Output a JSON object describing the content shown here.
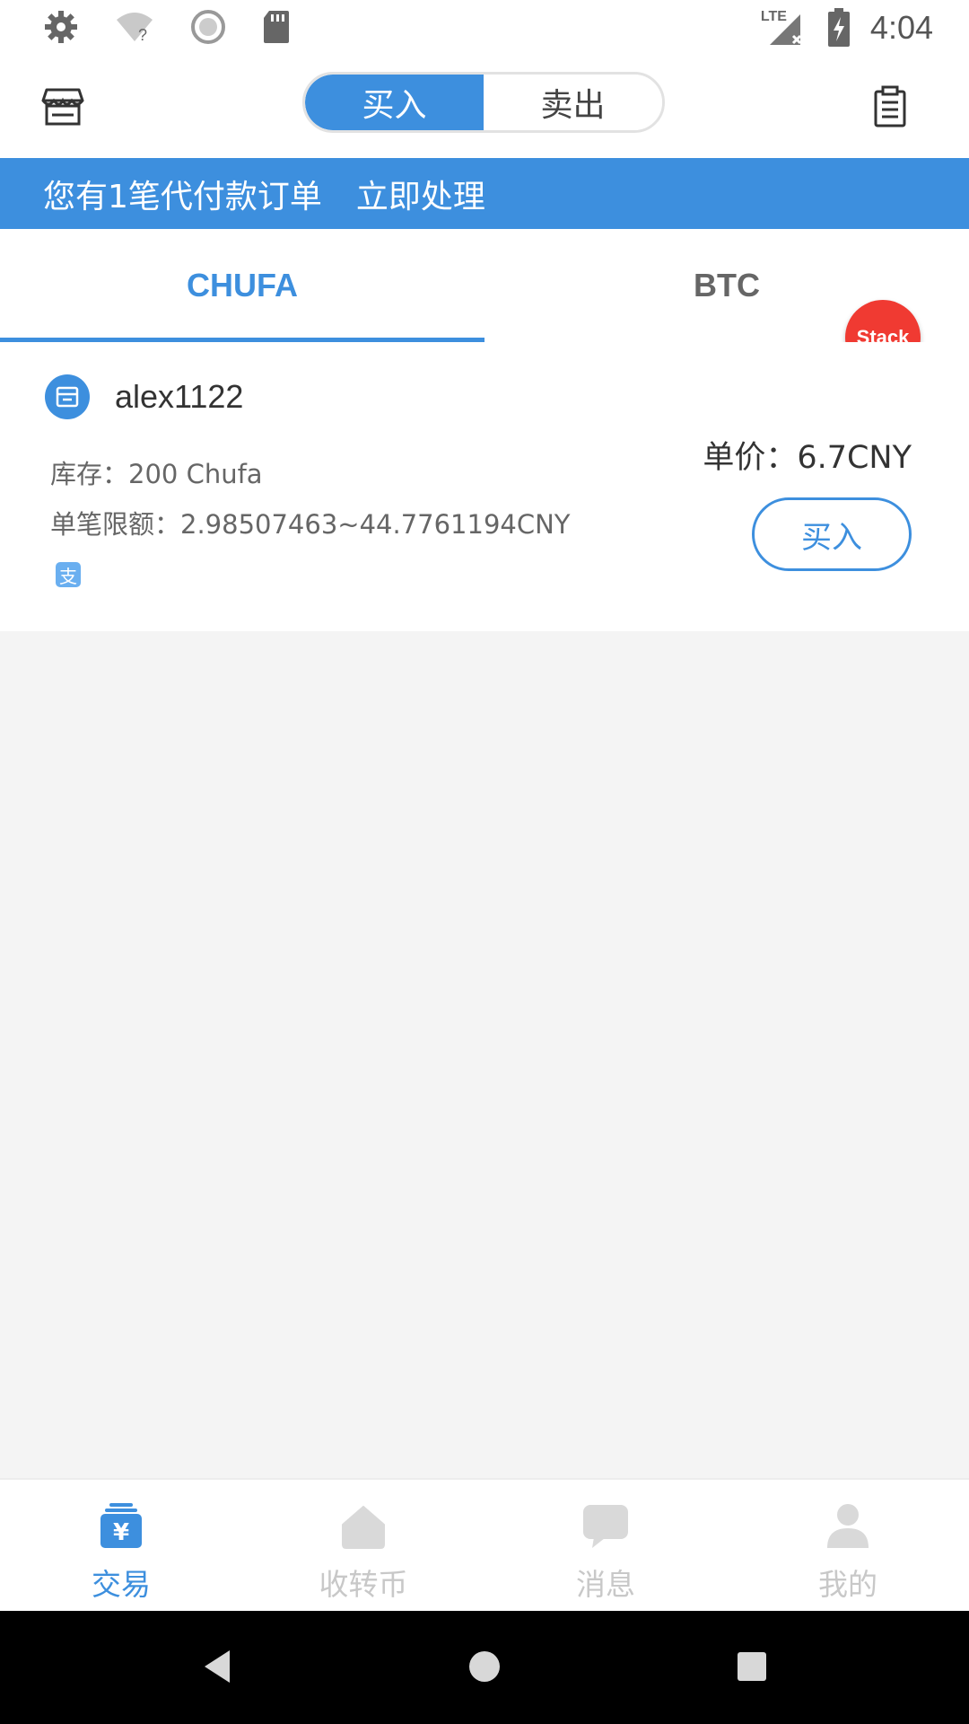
{
  "status_bar": {
    "network": "LTE",
    "time": "4:04"
  },
  "header": {
    "segments": [
      {
        "label": "买入",
        "active": true
      },
      {
        "label": "卖出",
        "active": false
      }
    ],
    "left_icon": "shop-icon",
    "right_icon": "orders-clipboard-icon"
  },
  "banner": {
    "message": "您有1笔代付款订单",
    "action": "立即处理"
  },
  "coin_tabs": [
    {
      "label": "CHUFA",
      "active": true
    },
    {
      "label": "BTC",
      "active": false
    }
  ],
  "stack_badge": "Stack",
  "offer": {
    "merchant": "alex1122",
    "stock": "库存：200 Chufa",
    "limit": "单笔限额：2.98507463~44.7761194CNY",
    "price": "单价：6.7CNY",
    "buy_label": "买入",
    "payment_icon": "alipay-icon",
    "payment_glyph": "支"
  },
  "bottom_nav": [
    {
      "label": "交易",
      "icon": "trade-yen-icon",
      "active": true
    },
    {
      "label": "收转币",
      "icon": "receive-transfer-icon",
      "active": false
    },
    {
      "label": "消息",
      "icon": "message-icon",
      "active": false
    },
    {
      "label": "我的",
      "icon": "profile-icon",
      "active": false
    }
  ],
  "colors": {
    "accent": "#3d8fde",
    "badge": "#f03a32",
    "background": "#f4f4f4"
  }
}
